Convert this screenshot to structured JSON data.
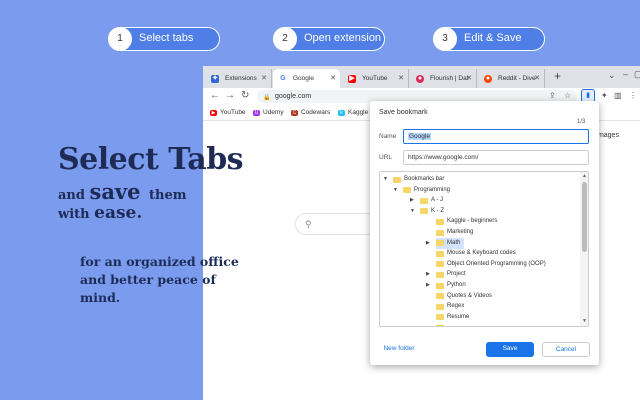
{
  "steps": [
    {
      "num": "1",
      "label": "Select tabs"
    },
    {
      "num": "2",
      "label": "Open extension"
    },
    {
      "num": "3",
      "label": "Edit & Save"
    }
  ],
  "hero": {
    "title": "Select Tabs",
    "line2_a": "and",
    "line2_b": "save",
    "line2_c": "them",
    "line3_a": "with",
    "line3_b": "ease.",
    "subtitle": "for an organized office and better peace of mind."
  },
  "browser": {
    "tabs": [
      {
        "label": "Extensions",
        "icon": "puzzle-icon",
        "color": "#3367d6"
      },
      {
        "label": "Google",
        "icon": "google-icon",
        "color": "#4285f4",
        "active": true
      },
      {
        "label": "YouTube",
        "icon": "youtube-icon",
        "color": "#ff0000"
      },
      {
        "label": "Flourish | Dat",
        "icon": "flourish-icon",
        "color": "#e0245e"
      },
      {
        "label": "Reddit - Dive",
        "icon": "reddit-icon",
        "color": "#ff4500"
      }
    ],
    "url": "google.com",
    "bookmarks": [
      {
        "label": "YouTube",
        "color": "#ff0000"
      },
      {
        "label": "Udemy",
        "color": "#a435f0"
      },
      {
        "label": "Codewars",
        "color": "#b1361e"
      },
      {
        "label": "Kaggle",
        "color": "#20beff"
      }
    ],
    "images_link": "Images"
  },
  "dialog": {
    "title": "Save bookmark",
    "pager": "1/3",
    "name_label": "Name",
    "name_value": "Google",
    "url_label": "URL",
    "url_value": "https://www.google.com/",
    "tree": [
      {
        "label": "Bookmarks bar",
        "level": 0,
        "arrow": "down"
      },
      {
        "label": "Programming",
        "level": 1,
        "arrow": "down"
      },
      {
        "label": "A - J",
        "level": 2,
        "arrow": "right"
      },
      {
        "label": "K - Z",
        "level": 2,
        "arrow": "down"
      },
      {
        "label": "Kaggle - beginners",
        "level": 3,
        "arrow": ""
      },
      {
        "label": "Marketing",
        "level": 3,
        "arrow": ""
      },
      {
        "label": "Math",
        "level": 3,
        "arrow": "right",
        "selected": true
      },
      {
        "label": "Mouse & Keyboard codes",
        "level": 3,
        "arrow": ""
      },
      {
        "label": "Object Oriented Programming (OOP)",
        "level": 3,
        "arrow": ""
      },
      {
        "label": "Project",
        "level": 3,
        "arrow": "right"
      },
      {
        "label": "Python",
        "level": 3,
        "arrow": "right"
      },
      {
        "label": "Quotes & Videos",
        "level": 3,
        "arrow": ""
      },
      {
        "label": "Regex",
        "level": 3,
        "arrow": ""
      },
      {
        "label": "Resume",
        "level": 3,
        "arrow": ""
      },
      {
        "label": "",
        "level": 3,
        "arrow": ""
      }
    ],
    "new_folder": "New folder",
    "save": "Save",
    "cancel": "Cancel"
  }
}
